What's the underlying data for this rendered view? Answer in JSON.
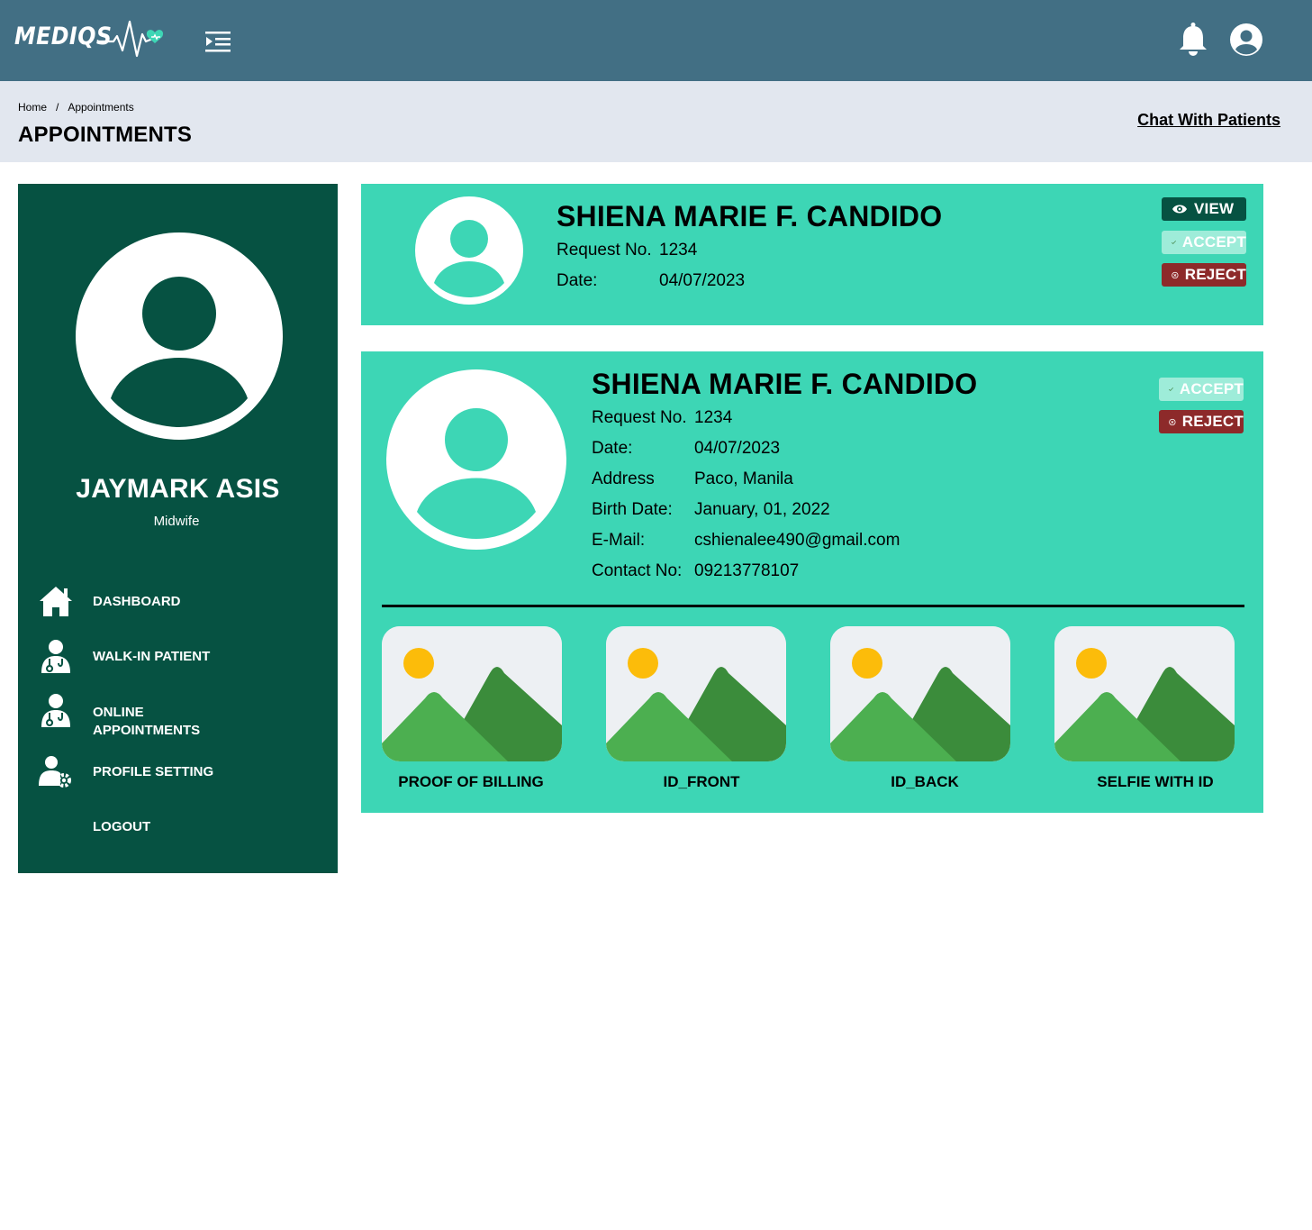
{
  "header": {
    "logo_text": "MEDIQS",
    "icons": {
      "menu": "menu-toggle-icon",
      "notifications": "bell-icon",
      "account": "user-circle-icon"
    }
  },
  "breadcrumb": {
    "home": "Home",
    "separator": "/",
    "current": "Appointments"
  },
  "page_title": "APPOINTMENTS",
  "chat_link": "Chat With Patients",
  "sidebar": {
    "user_name": "JAYMARK ASIS",
    "user_role": "Midwife",
    "nav": [
      {
        "label": "DASHBOARD",
        "icon": "home-icon"
      },
      {
        "label": "WALK-IN PATIENT",
        "icon": "doctor-icon"
      },
      {
        "label": "ONLINE",
        "label2": "APPOINTMENTS",
        "icon": "doctor-icon"
      },
      {
        "label": "PROFILE SETTING",
        "icon": "user-settings-icon"
      },
      {
        "label": "LOGOUT"
      }
    ]
  },
  "appointments": [
    {
      "name": "SHIENA MARIE F. CANDIDO",
      "request_label": "Request No.",
      "request_no": "1234",
      "date_label": "Date:",
      "date": "04/07/2023",
      "buttons": {
        "view": "VIEW",
        "accept": "ACCEPT",
        "reject": "REJECT"
      }
    },
    {
      "name": "SHIENA MARIE F. CANDIDO",
      "fields": [
        {
          "label": "Request No.",
          "value": "1234"
        },
        {
          "label": "Date:",
          "value": "04/07/2023"
        },
        {
          "label": "Address",
          "value": "Paco, Manila"
        },
        {
          "label": "Birth Date:",
          "value": "January, 01, 2022"
        },
        {
          "label": "E-Mail:",
          "value": "cshienalee490@gmail.com"
        },
        {
          "label": "Contact No:",
          "value": "09213778107"
        }
      ],
      "buttons": {
        "accept": "ACCEPT",
        "reject": "REJECT"
      },
      "documents": [
        "PROOF OF BILLING",
        "ID_FRONT",
        "ID_BACK",
        "SELFIE WITH ID"
      ]
    }
  ],
  "colors": {
    "topbar": "#426f84",
    "subbar": "#e2e7ef",
    "sidebar": "#065242",
    "card": "#3dd6b5",
    "view_button": "#065242",
    "accept_button": "#9eecd9",
    "reject_button": "#8d2a2a"
  }
}
